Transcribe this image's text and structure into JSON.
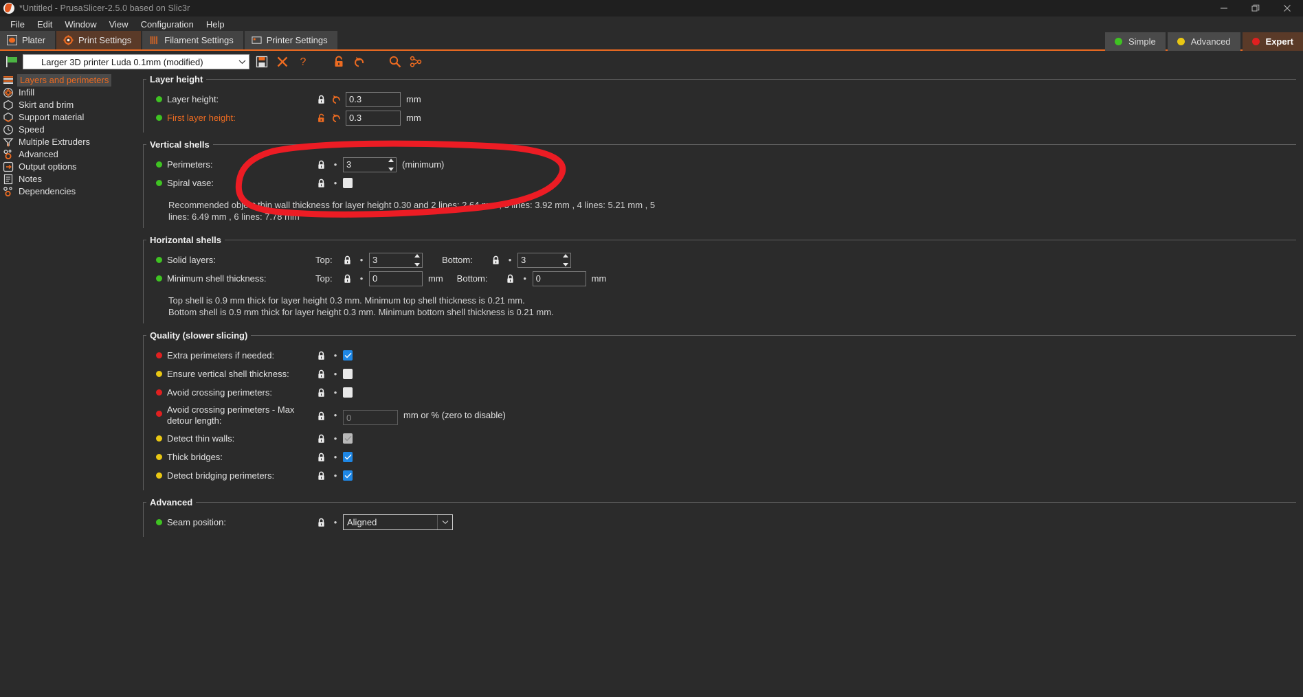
{
  "window": {
    "title": "*Untitled - PrusaSlicer-2.5.0 based on Slic3r",
    "minimize_label": "Minimize",
    "maximize_label": "Restore",
    "close_label": "Close"
  },
  "menubar": {
    "items": [
      {
        "label": "File"
      },
      {
        "label": "Edit"
      },
      {
        "label": "Window"
      },
      {
        "label": "View"
      },
      {
        "label": "Configuration"
      },
      {
        "label": "Help"
      }
    ]
  },
  "tabs": [
    {
      "label": "Plater",
      "icon": "plater-icon",
      "active": false
    },
    {
      "label": "Print Settings",
      "icon": "print-settings-icon",
      "active": true
    },
    {
      "label": "Filament Settings",
      "icon": "filament-settings-icon",
      "active": false
    },
    {
      "label": "Printer Settings",
      "icon": "printer-settings-icon",
      "active": false
    }
  ],
  "modes": [
    {
      "label": "Simple",
      "color": "#3fc322",
      "active": false
    },
    {
      "label": "Advanced",
      "color": "#e9c713",
      "active": false
    },
    {
      "label": "Expert",
      "color": "#e02020",
      "active": true
    }
  ],
  "preset": {
    "value": "Larger 3D printer Luda 0.1mm (modified)",
    "flag_icon": "green-flag-icon",
    "dropdown_icon": "chevron-down-icon",
    "tools": [
      {
        "name": "save-preset-icon",
        "label": "Save"
      },
      {
        "name": "delete-preset-icon",
        "label": "Delete"
      },
      {
        "name": "help-icon",
        "label": "Help"
      },
      {
        "name": "lock-all-icon",
        "label": "Lock"
      },
      {
        "name": "revert-all-icon",
        "label": "Revert"
      },
      {
        "name": "search-icon",
        "label": "Search"
      },
      {
        "name": "compare-presets-icon",
        "label": "Compare presets"
      }
    ]
  },
  "sidebar": {
    "items": [
      {
        "label": "Layers and perimeters",
        "icon": "layers-icon",
        "active": true
      },
      {
        "label": "Infill",
        "icon": "infill-icon",
        "active": false
      },
      {
        "label": "Skirt and brim",
        "icon": "skirt-icon",
        "active": false
      },
      {
        "label": "Support material",
        "icon": "support-icon",
        "active": false
      },
      {
        "label": "Speed",
        "icon": "speed-icon",
        "active": false
      },
      {
        "label": "Multiple Extruders",
        "icon": "extruders-icon",
        "active": false
      },
      {
        "label": "Advanced",
        "icon": "advanced-icon",
        "active": false
      },
      {
        "label": "Output options",
        "icon": "output-icon",
        "active": false
      },
      {
        "label": "Notes",
        "icon": "notes-icon",
        "active": false
      },
      {
        "label": "Dependencies",
        "icon": "dependencies-icon",
        "active": false
      }
    ]
  },
  "groups": {
    "layer_height": {
      "title": "Layer height",
      "rows": [
        {
          "label": "Layer height:",
          "bullet": "green",
          "value": "0.3",
          "unit": "mm",
          "locked": true,
          "modified_label": false
        },
        {
          "label": "First layer height:",
          "bullet": "green",
          "value": "0.3",
          "unit": "mm",
          "locked": false,
          "modified_label": true
        }
      ]
    },
    "vertical_shells": {
      "title": "Vertical shells",
      "perimeters": {
        "label": "Perimeters:",
        "bullet": "green",
        "value": "3",
        "suffix": "(minimum)"
      },
      "spiral_vase": {
        "label": "Spiral vase:",
        "bullet": "green",
        "checked": false
      },
      "note": "Recommended object thin wall thickness for layer height 0.30 and 2 lines: 2.64 mm , 3 lines: 3.92 mm , 4 lines: 5.21 mm , 5 lines: 6.49 mm , 6 lines: 7.78 mm"
    },
    "horizontal_shells": {
      "title": "Horizontal shells",
      "solid_layers": {
        "label": "Solid layers:",
        "bullet": "green",
        "top_label": "Top:",
        "top_value": "3",
        "bottom_label": "Bottom:",
        "bottom_value": "3"
      },
      "min_shell": {
        "label": "Minimum shell thickness:",
        "bullet": "green",
        "top_label": "Top:",
        "top_value": "0",
        "top_unit": "mm",
        "bottom_label": "Bottom:",
        "bottom_value": "0",
        "bottom_unit": "mm"
      },
      "note_line1": "Top shell is 0.9 mm thick for layer height 0.3 mm. Minimum top shell thickness is 0.21 mm.",
      "note_line2": "Bottom shell is 0.9 mm thick for layer height 0.3 mm. Minimum bottom shell thickness is 0.21 mm."
    },
    "quality": {
      "title": "Quality (slower slicing)",
      "rows": [
        {
          "label": "Extra perimeters if needed:",
          "bullet": "red",
          "type": "checkbox",
          "checked": true,
          "state": "on"
        },
        {
          "label": "Ensure vertical shell thickness:",
          "bullet": "yellow",
          "type": "checkbox",
          "checked": false,
          "state": "off"
        },
        {
          "label": "Avoid crossing perimeters:",
          "bullet": "red",
          "type": "checkbox",
          "checked": false,
          "state": "off"
        },
        {
          "label": "Avoid crossing perimeters - Max detour length:",
          "bullet": "red",
          "type": "text",
          "value": "",
          "placeholder": "0",
          "unit": "mm or % (zero to disable)",
          "disabled": true
        },
        {
          "label": "Detect thin walls:",
          "bullet": "yellow",
          "type": "checkbox",
          "checked": true,
          "state": "dim"
        },
        {
          "label": "Thick bridges:",
          "bullet": "yellow",
          "type": "checkbox",
          "checked": true,
          "state": "on"
        },
        {
          "label": "Detect bridging perimeters:",
          "bullet": "yellow",
          "type": "checkbox",
          "checked": true,
          "state": "on"
        }
      ]
    },
    "advanced": {
      "title": "Advanced",
      "seam_position": {
        "label": "Seam position:",
        "bullet": "green",
        "value": "Aligned"
      }
    }
  },
  "annotation": {
    "name": "red-circle-highlight",
    "color": "#ec1c24",
    "describes": "Layer height"
  }
}
